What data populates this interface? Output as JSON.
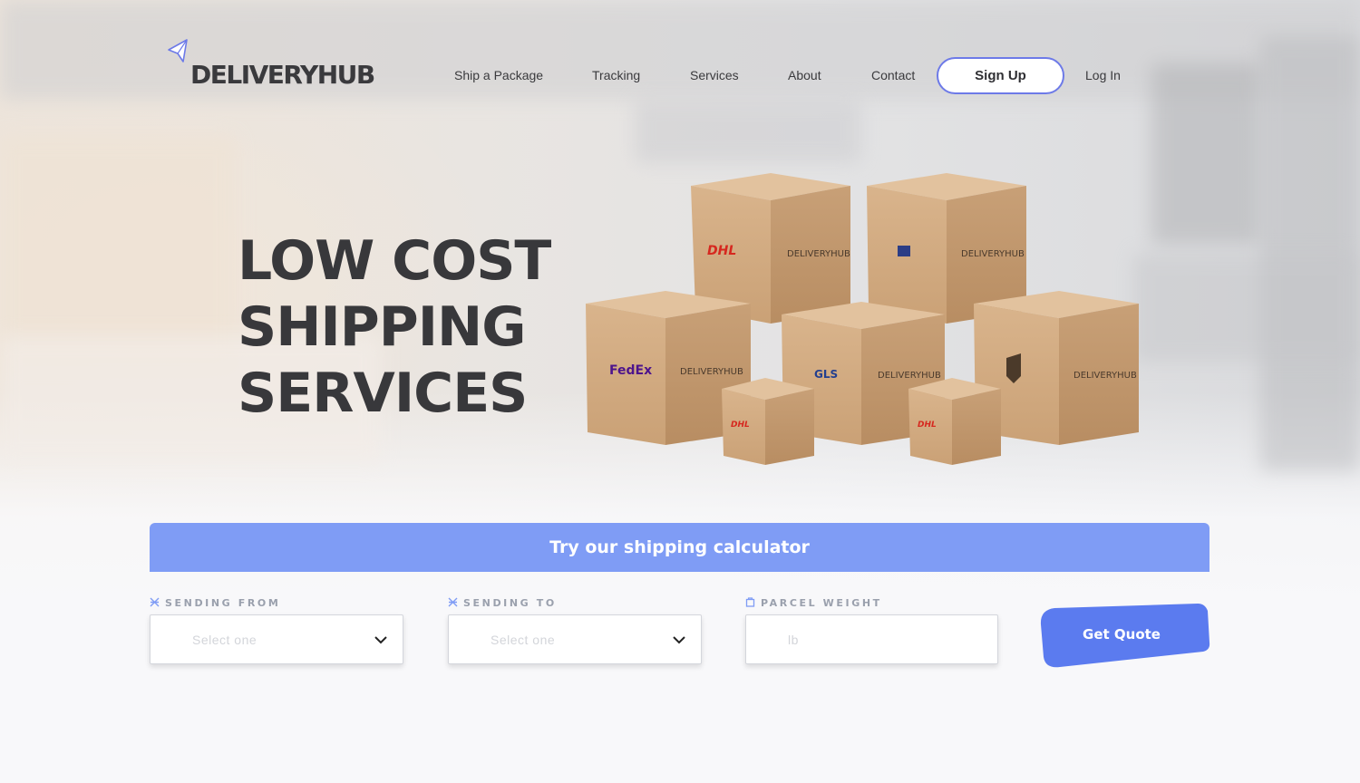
{
  "brand": {
    "name": "DELIVERYHUB"
  },
  "nav": {
    "links": [
      "Ship a Package",
      "Tracking",
      "Services",
      "About",
      "Contact"
    ],
    "signup_label": "Sign Up",
    "login_label": "Log In"
  },
  "hero": {
    "headline_lines": [
      "LOW COST",
      "SHIPPING",
      "SERVICES"
    ],
    "box_labels": {
      "dhl": "DHL",
      "fedex": "FedEx",
      "gls": "GLS",
      "deliveryhub": "DELIVERYHUB"
    }
  },
  "calculator": {
    "banner": "Try our shipping calculator",
    "sending_from": {
      "label": "SENDING FROM",
      "placeholder": "Select one"
    },
    "sending_to": {
      "label": "SENDING TO",
      "placeholder": "Select one"
    },
    "parcel_weight": {
      "label": "PARCEL WEIGHT",
      "placeholder": "lb"
    },
    "quote_button": "Get Quote"
  },
  "colors": {
    "accent": "#6d7ae8",
    "banner": "#7f9cf5",
    "button": "#5b7bef",
    "text_dark": "#38383b"
  }
}
